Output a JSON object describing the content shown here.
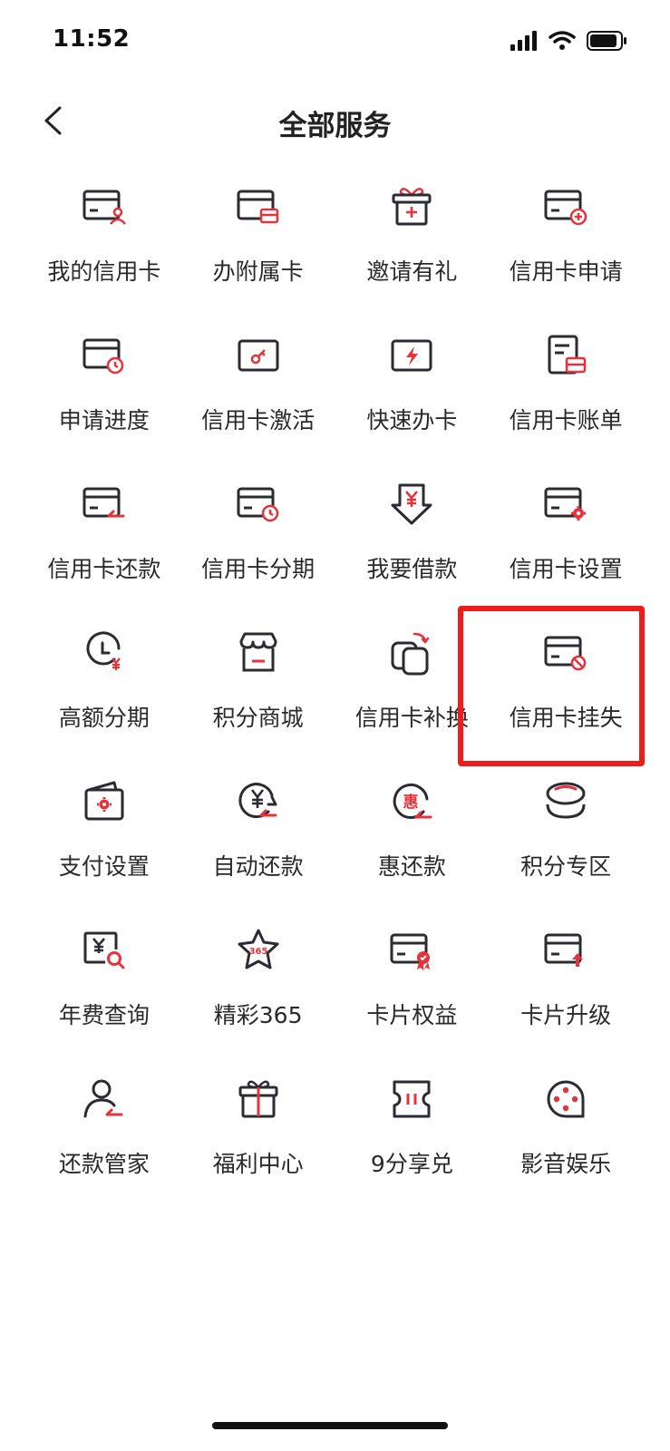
{
  "status_bar": {
    "time": "11:52"
  },
  "header": {
    "title": "全部服务"
  },
  "accent_color": "#e6333b",
  "highlight_color": "#f01c1c",
  "services": [
    {
      "label": "我的信用卡",
      "icon": "card-user-icon"
    },
    {
      "label": "办附属卡",
      "icon": "card-sub-icon"
    },
    {
      "label": "邀请有礼",
      "icon": "gift-box-icon"
    },
    {
      "label": "信用卡申请",
      "icon": "card-plus-icon"
    },
    {
      "label": "申请进度",
      "icon": "card-progress-icon"
    },
    {
      "label": "信用卡激活",
      "icon": "card-key-icon"
    },
    {
      "label": "快速办卡",
      "icon": "card-lightning-icon"
    },
    {
      "label": "信用卡账单",
      "icon": "bill-icon"
    },
    {
      "label": "信用卡还款",
      "icon": "card-repay-icon"
    },
    {
      "label": "信用卡分期",
      "icon": "card-clock-icon"
    },
    {
      "label": "我要借款",
      "icon": "yuan-shield-icon"
    },
    {
      "label": "信用卡设置",
      "icon": "card-gear-icon"
    },
    {
      "label": "高额分期",
      "icon": "clock-yuan-icon"
    },
    {
      "label": "积分商城",
      "icon": "store-icon"
    },
    {
      "label": "信用卡补换",
      "icon": "card-replace-icon"
    },
    {
      "label": "信用卡挂失",
      "icon": "card-block-icon"
    },
    {
      "label": "支付设置",
      "icon": "wallet-gear-icon"
    },
    {
      "label": "自动还款",
      "icon": "yuan-cycle-icon"
    },
    {
      "label": "惠还款",
      "icon": "hui-repay-icon"
    },
    {
      "label": "积分专区",
      "icon": "coins-icon"
    },
    {
      "label": "年费查询",
      "icon": "fee-search-icon"
    },
    {
      "label": "精彩365",
      "icon": "star-365-icon"
    },
    {
      "label": "卡片权益",
      "icon": "card-badge-icon"
    },
    {
      "label": "卡片升级",
      "icon": "card-upgrade-icon"
    },
    {
      "label": "还款管家",
      "icon": "person-icon"
    },
    {
      "label": "福利中心",
      "icon": "gift-icon"
    },
    {
      "label": "9分享兑",
      "icon": "ticket-icon"
    },
    {
      "label": "影音娱乐",
      "icon": "film-reel-icon"
    }
  ]
}
